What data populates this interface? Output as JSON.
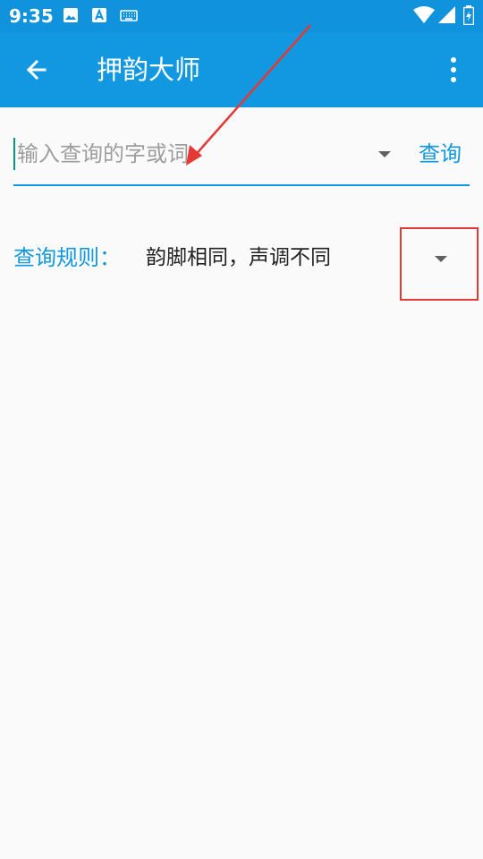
{
  "status_bar": {
    "time": "9:35",
    "icons": [
      "image-icon",
      "font-icon",
      "keyboard-icon",
      "wifi-icon",
      "signal-icon",
      "battery-icon"
    ]
  },
  "toolbar": {
    "title": "押韵大师",
    "back_icon": "arrow-back-icon",
    "more_icon": "more-vert-icon"
  },
  "search": {
    "placeholder": "输入查询的字或词",
    "value": "",
    "button_label": "查询",
    "dropdown_icon": "dropdown-icon"
  },
  "rule": {
    "label": "查询规则：",
    "value": "韵脚相同，声调不同",
    "dropdown_icon": "dropdown-icon"
  },
  "colors": {
    "primary": "#1298e0",
    "status_bar": "#1092dc",
    "background": "#fafafa",
    "annotation": "#e53935"
  }
}
